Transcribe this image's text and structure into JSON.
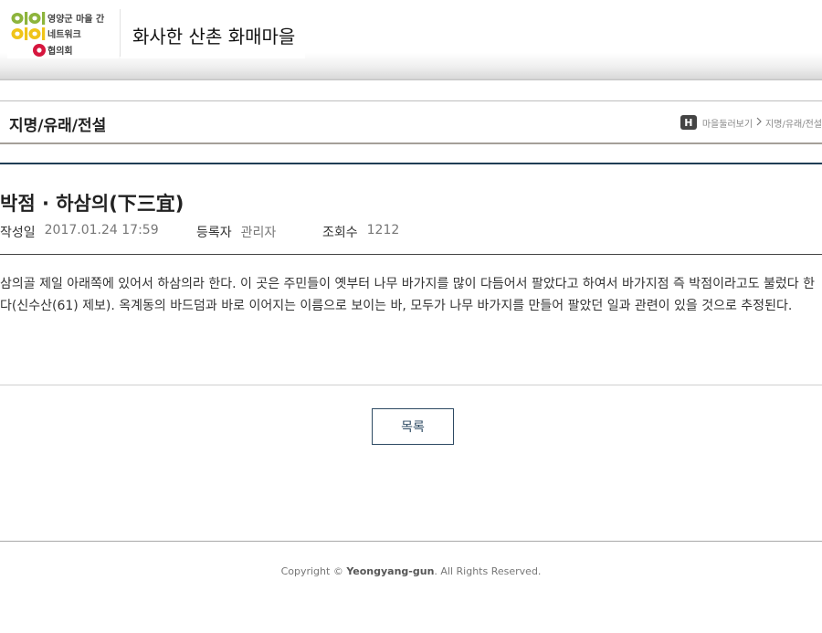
{
  "header": {
    "logo": {
      "line1": "영양군 마을 간",
      "line2": "네트워크",
      "line3": "협의회",
      "colors": {
        "green": "#8db43c",
        "yellow": "#f0c419",
        "red": "#d6163e"
      }
    },
    "site_title": "화사한 산촌 화매마을"
  },
  "page": {
    "title": "지명/유래/전설",
    "breadcrumb": {
      "home_icon_label": "H",
      "items": [
        "마을둘러보기",
        "지명/유래/전설"
      ]
    }
  },
  "article": {
    "title": "박점 · 하삼의(下三宜)",
    "meta": [
      {
        "label": "작성일",
        "value": "2017.01.24 17:59"
      },
      {
        "label": "등록자",
        "value": "관리자"
      },
      {
        "label": "조회수",
        "value": "1212"
      }
    ],
    "body": "삼의골 제일 아래쪽에 있어서 하삼의라 한다. 이 곳은 주민들이 옛부터 나무 바가지를 많이 다듬어서 팔았다고 하여서 바가지점 즉 박점이라고도 불렀다 한다(신수산(61) 제보). 옥계동의 바드덤과 바로 이어지는 이름으로 보이는 바, 모두가 나무 바가지를 만들어 팔았던 일과 관련이 있을 것으로 추정된다."
  },
  "actions": {
    "list_button": "목록"
  },
  "footer": {
    "prefix": "Copyright © ",
    "brand": "Yeongyang-gun",
    "suffix": ". All Rights Reserved."
  },
  "colors": {
    "accent_navy": "#1f3d55",
    "button_border": "#2d4a63"
  }
}
